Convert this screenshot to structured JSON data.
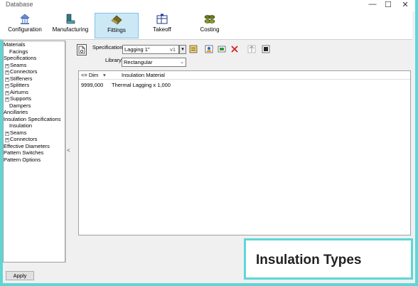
{
  "window": {
    "title": "Database"
  },
  "window_controls": {
    "minimize": "—",
    "maximize": "☐",
    "close": "✕"
  },
  "toolbar": {
    "configuration": "Configuration",
    "manufacturing": "Manufacturing",
    "fittings": "Fittings",
    "takeoff": "Takeoff",
    "costing": "Costing"
  },
  "tree": {
    "items": [
      {
        "label": "Materials"
      },
      {
        "label": "Facings"
      },
      {
        "label": "Specifications"
      },
      {
        "label": "Seams",
        "expander": "+"
      },
      {
        "label": "Connectors",
        "expander": "+"
      },
      {
        "label": "Stiffeners",
        "expander": "+"
      },
      {
        "label": "Splitters",
        "expander": "+"
      },
      {
        "label": "Airturns",
        "expander": "+"
      },
      {
        "label": "Supports",
        "expander": "+"
      },
      {
        "label": "Dampers"
      },
      {
        "label": "Ancillaries"
      },
      {
        "label": "Insulation Specifications"
      },
      {
        "label": "Insulation"
      },
      {
        "label": "Seams",
        "expander": "+"
      },
      {
        "label": "Connectors",
        "expander": "+"
      },
      {
        "label": "Effective Diameters"
      },
      {
        "label": "Pattern Switches"
      },
      {
        "label": "Pattern Options"
      }
    ]
  },
  "form": {
    "specification_label": "Specification",
    "specification_value": "Lagging 1\"",
    "specification_version": "v1",
    "library_label": "Library",
    "library_value": "Rectangular"
  },
  "grid": {
    "columns": [
      "<= Dim",
      "Insulation Material"
    ],
    "rows": [
      {
        "dim": "9999,000",
        "material": "Thermal Lagging x 1,000"
      }
    ]
  },
  "splitter_arrow": "<",
  "apply_label": "Apply",
  "caption": "Insulation Types",
  "colors": {
    "frame": "#5fd6d6",
    "active_tab": "#cce8f6"
  }
}
